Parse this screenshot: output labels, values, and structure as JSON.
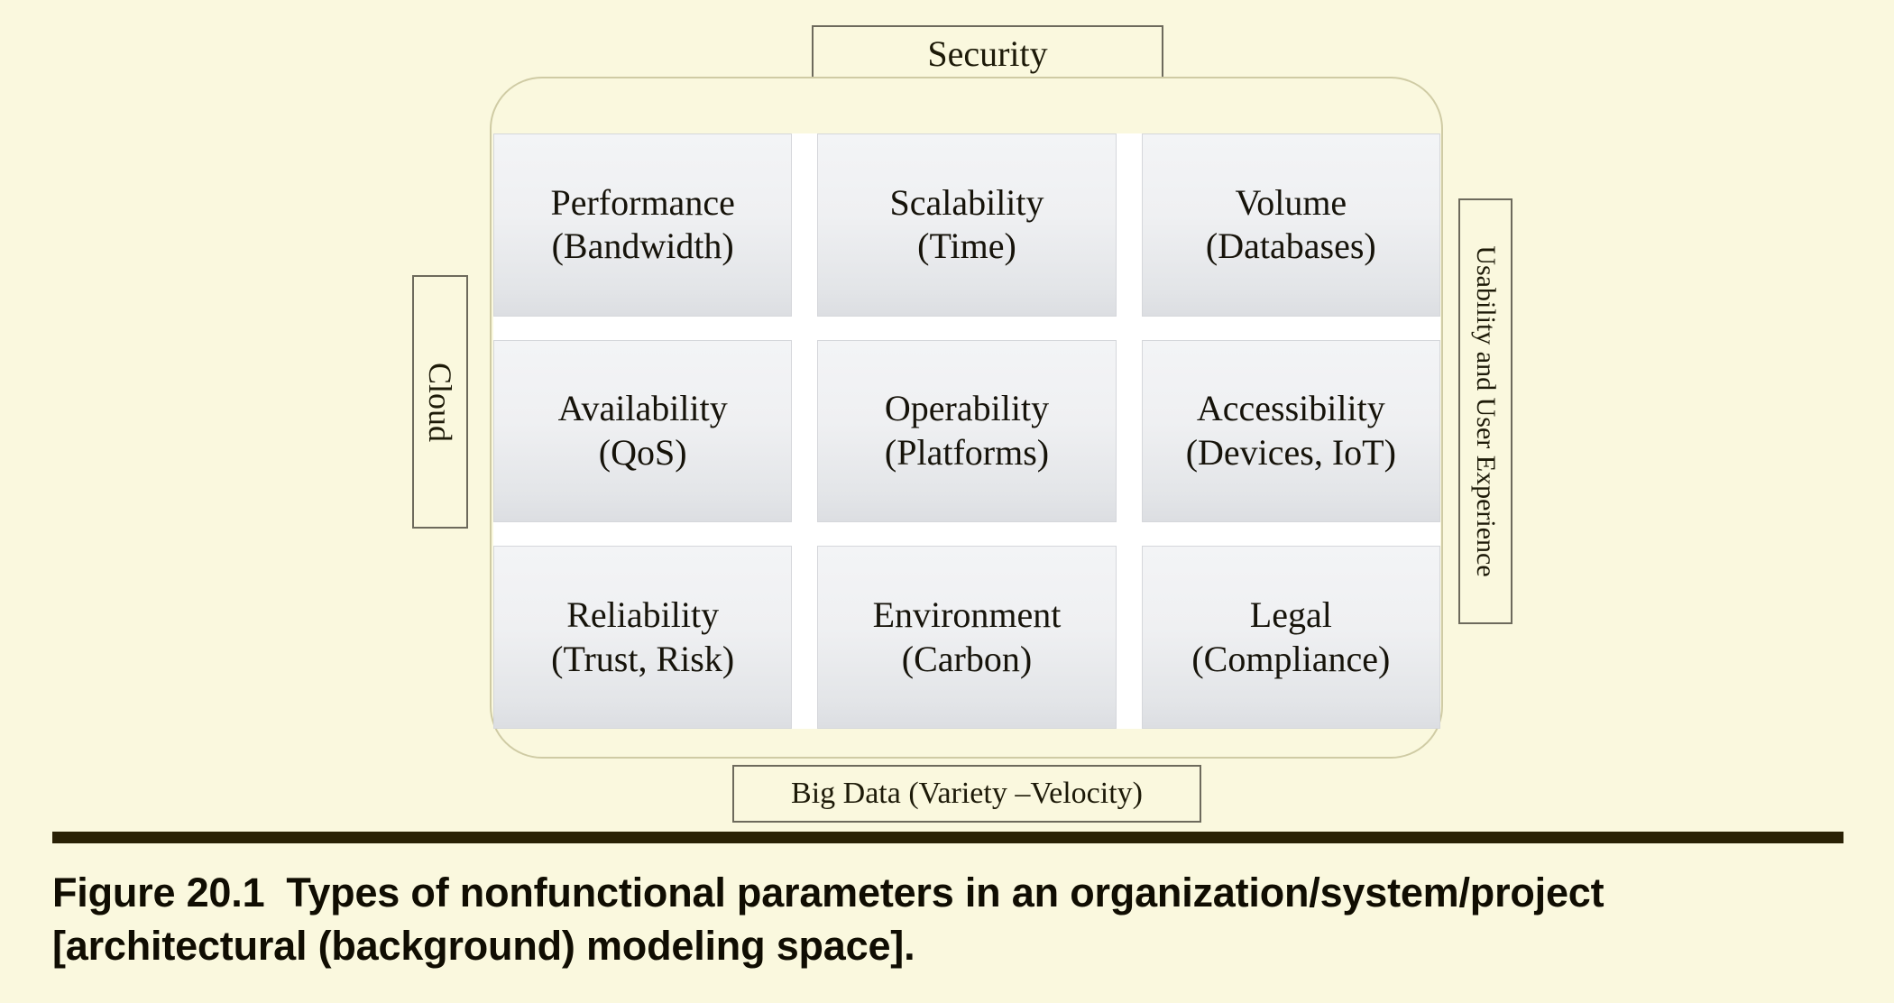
{
  "figure": {
    "top_label": "Security",
    "bottom_label": "Big Data (Variety –Velocity)",
    "left_label": "Cloud",
    "right_label": "Usability and User Experience",
    "grid": {
      "rows": 3,
      "columns": 3,
      "cells": [
        {
          "title": "Performance",
          "detail": "(Bandwidth)"
        },
        {
          "title": "Scalability",
          "detail": "(Time)"
        },
        {
          "title": "Volume",
          "detail": "(Databases)"
        },
        {
          "title": "Availability",
          "detail": "(QoS)"
        },
        {
          "title": "Operability",
          "detail": "(Platforms)"
        },
        {
          "title": "Accessibility",
          "detail": "(Devices, IoT)"
        },
        {
          "title": "Reliability",
          "detail": "(Trust, Risk)"
        },
        {
          "title": "Environment",
          "detail": "(Carbon)"
        },
        {
          "title": "Legal",
          "detail": "(Compliance)"
        }
      ]
    }
  },
  "caption": {
    "figure_number": "Figure 20.1",
    "text": "Types of nonfunctional parameters in an organization/system/project [architectural (background) modeling space]."
  },
  "colors": {
    "page_background": "#faf8de",
    "container_border": "#cfcba4",
    "label_border": "#6d6a5c",
    "cell_gradient_top": "#f3f4f6",
    "cell_gradient_bottom": "#dcdee2",
    "cell_border": "#d5d7db",
    "grid_backdrop": "#ffffff",
    "caption_rule": "#292105",
    "text": "#16130a"
  }
}
